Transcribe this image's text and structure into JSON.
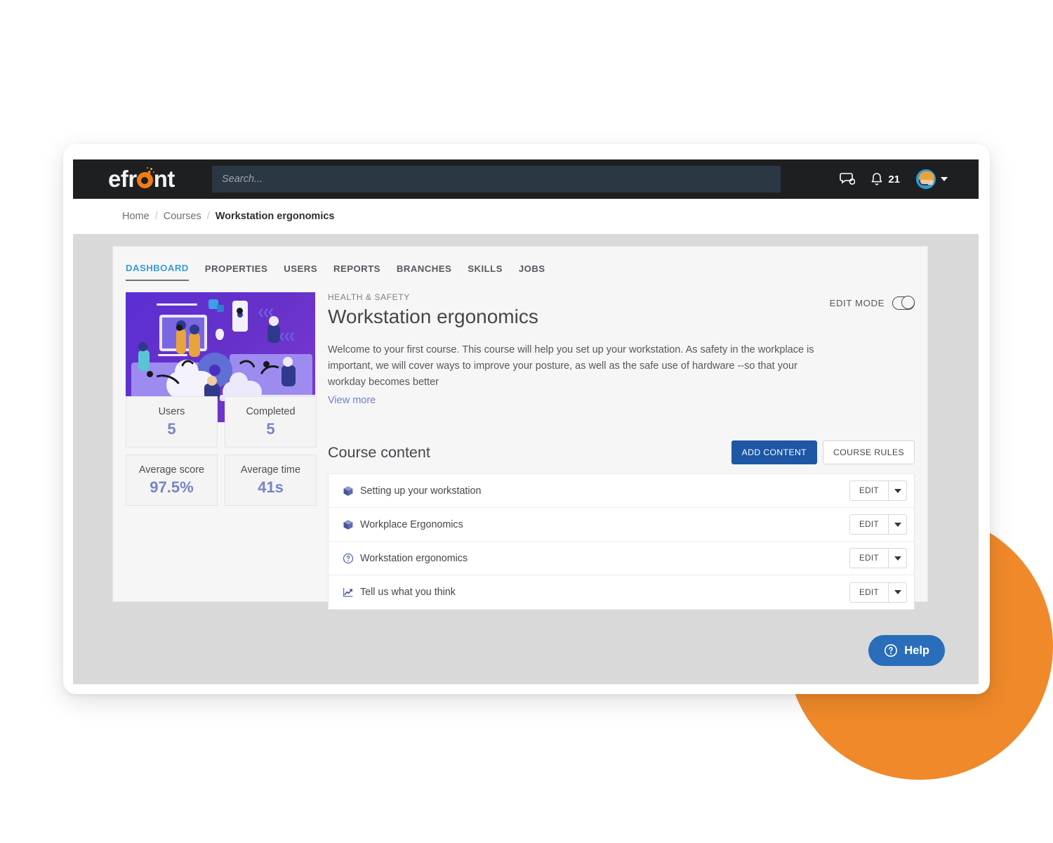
{
  "brand": {
    "name": "efront",
    "logo_icon": "bomb-icon",
    "accent": "#f07d18"
  },
  "topbar": {
    "search": {
      "placeholder": "Search...",
      "value": ""
    },
    "messages_icon": "chat-bubbles-icon",
    "notifications_icon": "bell-icon",
    "notifications_count": "21",
    "avatar_icon": "user-avatar",
    "avatar_caret_icon": "chevron-down-icon"
  },
  "breadcrumb": {
    "home": "Home",
    "courses": "Courses",
    "current": "Workstation ergonomics",
    "separator": "/"
  },
  "tabs": [
    {
      "label": "DASHBOARD",
      "active": true
    },
    {
      "label": "PROPERTIES",
      "active": false
    },
    {
      "label": "USERS",
      "active": false
    },
    {
      "label": "REPORTS",
      "active": false
    },
    {
      "label": "BRANCHES",
      "active": false
    },
    {
      "label": "SKILLS",
      "active": false
    },
    {
      "label": "JOBS",
      "active": false
    }
  ],
  "course": {
    "thumbnail_icon": "course-illustration",
    "category": "HEALTH & SAFETY",
    "title": "Workstation ergonomics",
    "description": "Welcome to your first course. This course will help you set up your workstation. As safety in the workplace is important, we will cover ways to improve your posture, as well as the safe use of hardware --so that your workday becomes better",
    "view_more": "View more",
    "edit_mode_label": "EDIT MODE",
    "edit_mode_on": true
  },
  "stats": [
    {
      "label": "Users",
      "value": "5"
    },
    {
      "label": "Completed",
      "value": "5"
    },
    {
      "label": "Average score",
      "value": "97.5%"
    },
    {
      "label": "Average time",
      "value": "41s"
    }
  ],
  "stats_value_color": "#7784c4",
  "content": {
    "title": "Course content",
    "add_button": "ADD CONTENT",
    "rules_button": "COURSE RULES",
    "edit_label": "EDIT",
    "items": [
      {
        "label": "Setting up your workstation",
        "icon": "cube-icon"
      },
      {
        "label": "Workplace Ergonomics",
        "icon": "cube-icon"
      },
      {
        "label": "Workstation ergonomics",
        "icon": "question-circle-icon"
      },
      {
        "label": "Tell us what you think",
        "icon": "chart-line-icon"
      }
    ]
  },
  "help": {
    "label": "Help",
    "icon": "question-circle-icon"
  }
}
